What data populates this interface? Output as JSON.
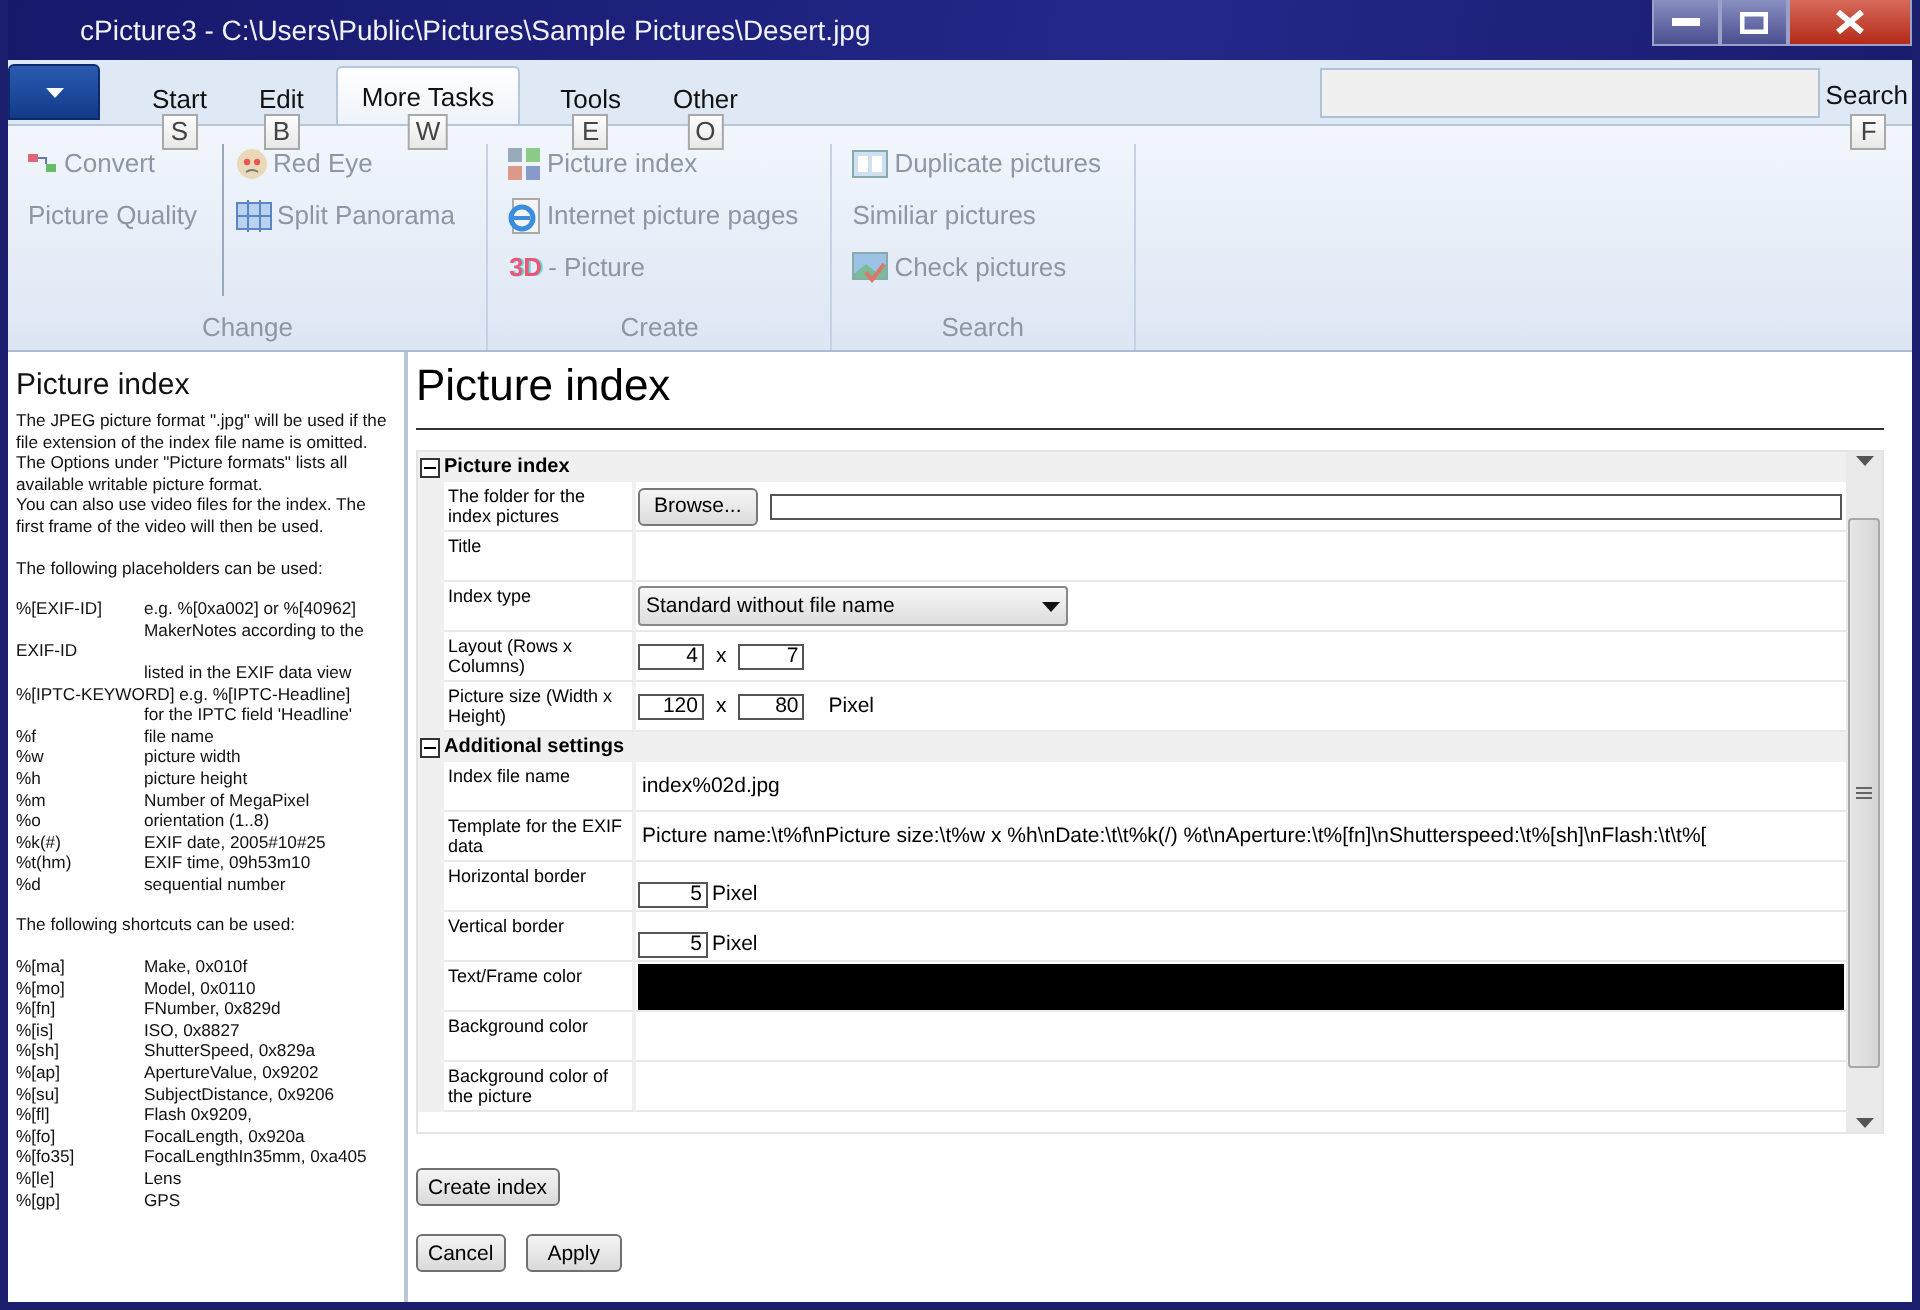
{
  "window": {
    "title": "cPicture3 - C:\\Users\\Public\\Pictures\\Sample Pictures\\Desert.jpg"
  },
  "tabs": [
    {
      "label": "Start",
      "keytip": "S",
      "selected": false
    },
    {
      "label": "Edit",
      "keytip": "B",
      "selected": false
    },
    {
      "label": "More Tasks",
      "keytip": "W",
      "selected": true
    },
    {
      "label": "Tools",
      "keytip": "E",
      "selected": false
    },
    {
      "label": "Other",
      "keytip": "O",
      "selected": false
    }
  ],
  "search": {
    "button": "Search",
    "keytip": "F"
  },
  "ribbon_groups": [
    {
      "title": "Change",
      "columns": [
        [
          {
            "label": "Convert",
            "disabled": true
          },
          {
            "label": "Picture Quality",
            "disabled": true
          }
        ],
        [
          {
            "label": "Red Eye",
            "disabled": true
          },
          {
            "label": "Split Panorama",
            "disabled": true
          }
        ]
      ]
    },
    {
      "title": "Create",
      "columns": [
        [
          {
            "label": "Picture index",
            "disabled": true
          },
          {
            "label": "Internet picture pages",
            "disabled": true
          },
          {
            "label": "- Picture",
            "badge": "3D",
            "disabled": true
          }
        ]
      ]
    },
    {
      "title": "Search",
      "columns": [
        [
          {
            "label": "Duplicate pictures",
            "disabled": true
          },
          {
            "label": "Similiar pictures",
            "disabled": true
          },
          {
            "label": "Check pictures",
            "disabled": true
          }
        ]
      ]
    }
  ],
  "help": {
    "title": "Picture index",
    "lines": [
      {
        "kind": "para",
        "text": "The JPEG picture format \".jpg\" will be used if the file extension of the index file name is omitted."
      },
      {
        "kind": "para",
        "text": "The Options under \"Picture formats\" lists all available writable picture format."
      },
      {
        "kind": "para",
        "text": "You can also use video files for the index. The first frame of the video will then be used."
      },
      {
        "kind": "section",
        "text": "The following placeholders can be used:"
      },
      {
        "kind": "pair",
        "key": "%[EXIF-ID]",
        "value": "e.g. %[0xa002] or %[40962]"
      },
      {
        "kind": "indent",
        "text": "MakerNotes according to the"
      },
      {
        "kind": "para",
        "text": "EXIF-ID"
      },
      {
        "kind": "indent",
        "text": "listed in the EXIF data view"
      },
      {
        "kind": "para",
        "text": "%[IPTC-KEYWORD] e.g. %[IPTC-Headline]"
      },
      {
        "kind": "indent",
        "text": "for the IPTC field 'Headline'"
      },
      {
        "kind": "pair",
        "key": "%f",
        "value": "file name"
      },
      {
        "kind": "pair",
        "key": "%w",
        "value": "picture width"
      },
      {
        "kind": "pair",
        "key": "%h",
        "value": "picture height"
      },
      {
        "kind": "pair",
        "key": "%m",
        "value": "Number of MegaPixel"
      },
      {
        "kind": "pair",
        "key": "%o",
        "value": "orientation (1..8)"
      },
      {
        "kind": "pair",
        "key": "%k(#)",
        "value": "EXIF date, 2005#10#25"
      },
      {
        "kind": "pair",
        "key": "%t(hm)",
        "value": "EXIF time, 09h53m10"
      },
      {
        "kind": "pair",
        "key": "%d",
        "value": "sequential number"
      },
      {
        "kind": "section",
        "text": "The following shortcuts can be used:"
      },
      {
        "kind": "pair",
        "key": "%[ma]",
        "value": "Make, 0x010f"
      },
      {
        "kind": "pair",
        "key": "%[mo]",
        "value": "Model, 0x0110"
      },
      {
        "kind": "pair",
        "key": "%[fn]",
        "value": "FNumber, 0x829d"
      },
      {
        "kind": "pair",
        "key": "%[is]",
        "value": "ISO, 0x8827"
      },
      {
        "kind": "pair",
        "key": "%[sh]",
        "value": "ShutterSpeed, 0x829a"
      },
      {
        "kind": "pair",
        "key": "%[ap]",
        "value": "ApertureValue, 0x9202"
      },
      {
        "kind": "pair",
        "key": "%[su]",
        "value": "SubjectDistance, 0x9206"
      },
      {
        "kind": "pair",
        "key": "%[fl]",
        "value": "Flash 0x9209,"
      },
      {
        "kind": "pair",
        "key": "%[fo]",
        "value": "FocalLength, 0x920a"
      },
      {
        "kind": "pair",
        "key": "%[fo35]",
        "value": "FocalLengthIn35mm, 0xa405"
      },
      {
        "kind": "pair",
        "key": "%[le]",
        "value": "Lens"
      },
      {
        "kind": "pair",
        "key": "%[gp]",
        "value": "GPS"
      }
    ]
  },
  "page_title": "Picture index",
  "categories": [
    {
      "title": "Picture index",
      "expanded": true,
      "rows": [
        {
          "label": "The folder for the index pictures",
          "kind": "browse",
          "button": "Browse..."
        },
        {
          "label": "Title",
          "kind": "empty"
        },
        {
          "label": "Index type",
          "kind": "dropdown",
          "value": "Standard without file name"
        },
        {
          "label": "Layout (Rows x Columns)",
          "kind": "pair",
          "a": "4",
          "sep": "x",
          "b": "7"
        },
        {
          "label": "Picture size (Width x Height)",
          "kind": "pair",
          "a": "120",
          "sep": "x",
          "b": "80",
          "unit": "Pixel"
        }
      ]
    },
    {
      "title": "Additional settings",
      "expanded": true,
      "rows": [
        {
          "label": "Index file name",
          "kind": "text",
          "value": "index%02d.jpg"
        },
        {
          "label": "Template for the EXIF data",
          "kind": "text",
          "value": "Picture name:\\t%f\\nPicture size:\\t%w x %h\\nDate:\\t\\t%k(/) %t\\nAperture:\\t%[fn]\\nShutterspeed:\\t%[sh]\\nFlash:\\t\\t%["
        },
        {
          "label": "Horizontal border",
          "kind": "number",
          "value": "5",
          "unit": "Pixel"
        },
        {
          "label": "Vertical border",
          "kind": "number",
          "value": "5",
          "unit": "Pixel"
        },
        {
          "label": "Text/Frame color",
          "kind": "color",
          "color": "#000000"
        },
        {
          "label": "Background color",
          "kind": "empty"
        },
        {
          "label": "Background color of the picture",
          "kind": "empty"
        }
      ]
    }
  ],
  "buttons": {
    "create": "Create index",
    "cancel": "Cancel",
    "apply": "Apply"
  }
}
